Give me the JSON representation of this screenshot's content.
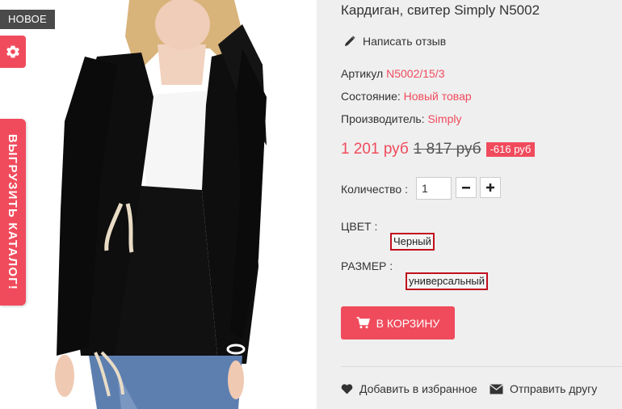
{
  "badges": {
    "new_label": "НОВОЕ"
  },
  "side_tab": {
    "catalog_label": "ВЫГРУЗИТЬ КАТАЛОГ!"
  },
  "product": {
    "title": "Кардиган, свитер Simply N5002",
    "review_link": "Написать отзыв",
    "sku_label": "Артикул",
    "sku_value": "N5002/15/3",
    "condition_label": "Состояние:",
    "condition_value": "Новый товар",
    "manufacturer_label": "Производитель:",
    "manufacturer_value": "Simply",
    "price_new": "1 201 руб",
    "price_old": "1 817 руб",
    "price_discount": "-616 руб",
    "quantity_label": "Количество :",
    "quantity_value": "1",
    "color_label": "ЦВЕТ :",
    "color_value": "Черный",
    "size_label": "РАЗМЕР :",
    "size_value": "универсальный",
    "add_to_cart": "В КОРЗИНУ",
    "add_to_wishlist": "Добавить в избранное",
    "send_to_friend": "Отправить другу"
  },
  "icons": {
    "gear": "gear-icon",
    "pencil": "pencil-icon",
    "minus": "minus-icon",
    "plus": "plus-icon",
    "cart": "cart-icon",
    "heart": "heart-icon",
    "envelope": "envelope-icon"
  },
  "colors": {
    "accent": "#f04b5c",
    "badge_bg": "#4a4a4a",
    "option_border": "#c0101e"
  }
}
